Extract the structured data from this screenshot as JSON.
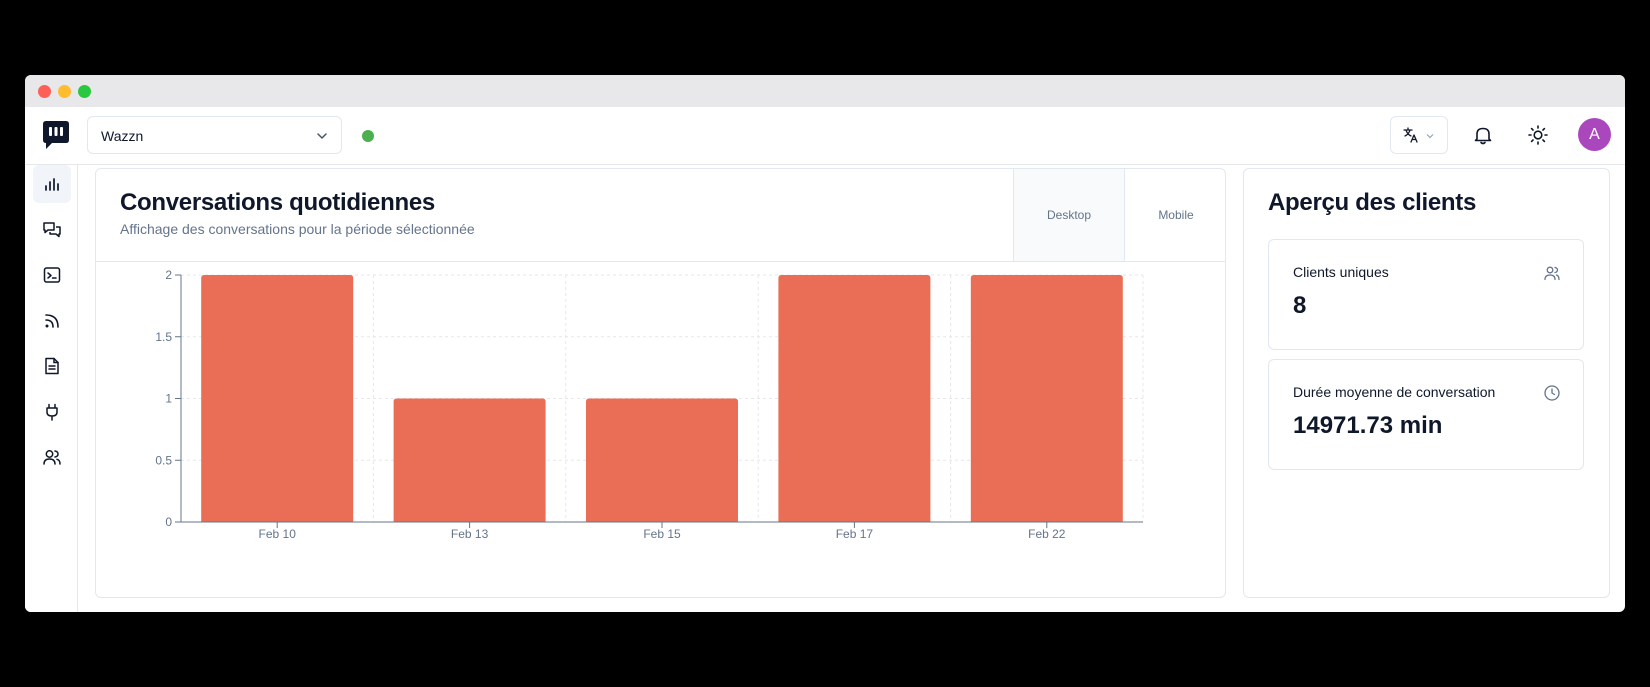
{
  "app": {
    "project_name": "Wazzn",
    "avatar_initial": "A",
    "status_color": "#4caf50",
    "accent_color": "#e96e55",
    "avatar_color": "#ab47bc"
  },
  "sidebar": {
    "items": [
      {
        "icon": "bar-chart-icon",
        "active": true
      },
      {
        "icon": "messages-icon",
        "active": false
      },
      {
        "icon": "terminal-icon",
        "active": false
      },
      {
        "icon": "rss-icon",
        "active": false
      },
      {
        "icon": "document-icon",
        "active": false
      },
      {
        "icon": "plug-icon",
        "active": false
      },
      {
        "icon": "users-icon",
        "active": false
      }
    ]
  },
  "main": {
    "title": "Conversations quotidiennes",
    "subtitle": "Affichage des conversations pour la période sélectionnée",
    "tabs": [
      "Desktop",
      "Mobile"
    ],
    "active_tab": "Desktop"
  },
  "chart_data": {
    "type": "bar",
    "categories": [
      "Feb 10",
      "Feb 13",
      "Feb 15",
      "Feb 17",
      "Feb 22"
    ],
    "values": [
      2,
      1,
      1,
      2,
      2
    ],
    "yticks": [
      "0",
      "0.5",
      "1",
      "1.5",
      "2"
    ],
    "ylim": [
      0,
      2
    ],
    "grid": true,
    "color": "#e96e55"
  },
  "overview": {
    "title": "Aperçu des clients",
    "stats": [
      {
        "label": "Clients uniques",
        "value": "8",
        "icon": "users-icon"
      },
      {
        "label": "Durée moyenne de conversation",
        "value": "14971.73 min",
        "icon": "clock-icon"
      }
    ]
  }
}
